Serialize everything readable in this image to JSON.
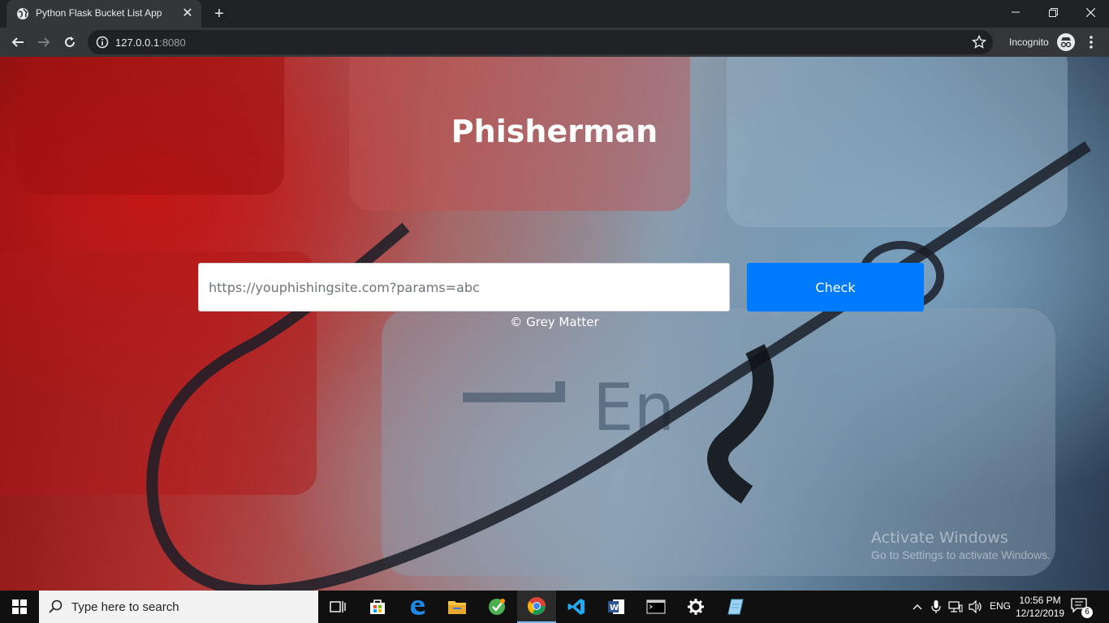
{
  "browser": {
    "tab_title": "Python Flask Bucket List App",
    "url_host": "127.0.0.1",
    "url_port": ":8080",
    "incognito_label": "Incognito"
  },
  "page": {
    "title": "Phisherman",
    "input_placeholder": "https://youphishingsite.com?params=abc",
    "check_label": "Check",
    "footer": "© Grey Matter"
  },
  "watermark": {
    "title": "Activate Windows",
    "subtitle": "Go to Settings to activate Windows."
  },
  "taskbar": {
    "search_placeholder": "Type here to search",
    "language": "ENG",
    "time": "10:56 PM",
    "date": "12/12/2019",
    "notification_count": "6",
    "apps": [
      "task-view-icon",
      "store-icon",
      "edge-icon",
      "file-explorer-icon",
      "app-icon",
      "chrome-icon",
      "vscode-icon",
      "word-icon",
      "terminal-icon",
      "settings-icon",
      "notes-icon"
    ]
  },
  "colors": {
    "accent": "#007bff",
    "chrome_dark": "#202124",
    "chrome_toolbar": "#35363a"
  }
}
